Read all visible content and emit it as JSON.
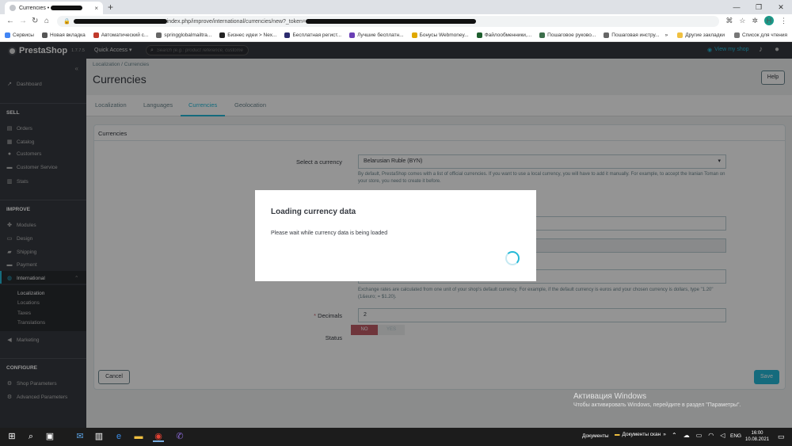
{
  "browser": {
    "tab_title": "Currencies •",
    "tab_close": "×",
    "new_tab": "+",
    "window_controls": [
      "—",
      "❐",
      "✕"
    ],
    "url_visible_1": "index.php/improve/international/currencies/new?_token=",
    "toolbar_icons": [
      "translate-icon",
      "star-icon",
      "extensions-icon"
    ],
    "profile_initial": "H",
    "menu_glyph": "⋮"
  },
  "bookmarks": {
    "items": [
      {
        "label": "Сервисы",
        "color": "#4285f4"
      },
      {
        "label": "Новая вкладка",
        "color": "#555555"
      },
      {
        "label": "Автоматический с...",
        "color": "#c0392b"
      },
      {
        "label": "springglobalmailtra...",
        "color": "#666666"
      },
      {
        "label": "Бизнес идеи > Nex...",
        "color": "#222222"
      },
      {
        "label": "Бесплатная регист...",
        "color": "#2c2c6e"
      },
      {
        "label": "Лучшие бесплатн...",
        "color": "#6a3fb5"
      },
      {
        "label": "Бонусы Webmoney...",
        "color": "#e0a800"
      },
      {
        "label": "Файлообменники,...",
        "color": "#1e5e2e"
      },
      {
        "label": "Пошаговое руково...",
        "color": "#3c6e4a"
      },
      {
        "label": "Пошаговая инстру...",
        "color": "#666666"
      }
    ],
    "more": "»",
    "other": "Другие закладки",
    "reading_list": "Список для чтения"
  },
  "ps_header": {
    "brand": "PrestaShop",
    "version": "1.7.7.5",
    "quick_access": "Quick Access ▾",
    "search_placeholder": "Search (e.g.: product reference, custome",
    "view_shop": "View my shop"
  },
  "sidebar": {
    "collapse": "«",
    "dashboard": "Dashboard",
    "sell_section": "SELL",
    "sell_items": [
      "Orders",
      "Catalog",
      "Customers",
      "Customer Service",
      "Stats"
    ],
    "improve_section": "IMPROVE",
    "improve_items": [
      "Modules",
      "Design",
      "Shipping",
      "Payment",
      "International"
    ],
    "international_sub": [
      "Localization",
      "Locations",
      "Taxes",
      "Translations"
    ],
    "marketing": "Marketing",
    "configure_section": "CONFIGURE",
    "configure_items": [
      "Shop Parameters",
      "Advanced Parameters"
    ]
  },
  "main": {
    "breadcrumb": "Localization  /  Currencies",
    "page_title": "Currencies",
    "help": "Help",
    "tabs": [
      "Localization",
      "Languages",
      "Currencies",
      "Geolocation"
    ],
    "active_tab": "Currencies",
    "panel_title": "Currencies",
    "select_currency_label": "Select a currency",
    "select_currency_value": "Belarusian Ruble (BYN)",
    "select_help": "By default, PrestaShop comes with a list of official currencies. If you want to use a local currency, you will have to add it manually. For example, to accept the Iranian Toman on your store, you need to create it before.",
    "exchange_help": "Exchange rates are calculated from one unit of your shop's default currency. For example, if the default currency is euros and your chosen currency is dollars, type \"1.20\" (1&euro; = $1.20).",
    "decimals_label": "Decimals",
    "decimals_required": "*",
    "decimals_value": "2",
    "status_label": "Status",
    "status_no": "NO",
    "status_yes": "YES",
    "status_selected": "NO",
    "cancel": "Cancel",
    "save": "Save"
  },
  "modal": {
    "title": "Loading currency data",
    "text": "Please wait while currency data is being loaded"
  },
  "windows_activation": {
    "line1": "Активация Windows",
    "line2": "Чтобы активировать Windows, перейдите в раздел \"Параметры\"."
  },
  "taskbar": {
    "docs1": "Документы",
    "docs2": "Документы скан",
    "more": "»",
    "lang": "ENG",
    "time": "16:00",
    "date": "10.08.2021"
  },
  "colors": {
    "accent": "#25b9d7",
    "danger": "#c05c67",
    "sidebar": "#363a41"
  }
}
